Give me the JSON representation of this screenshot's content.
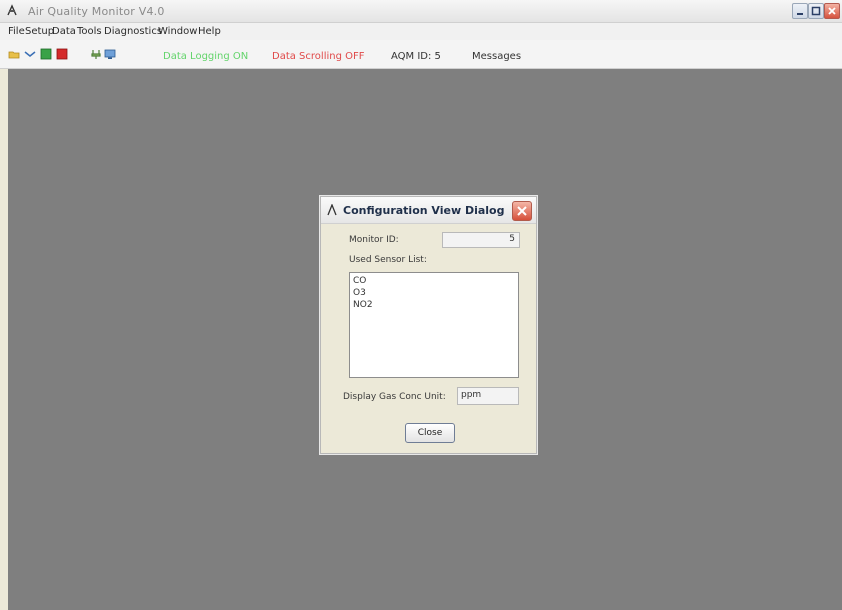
{
  "window": {
    "title": "Air Quality Monitor V4.0",
    "min_label": "",
    "max_label": "",
    "close_label": ""
  },
  "menu": [
    "File",
    "Setup",
    "Data",
    "Tools",
    "Diagnostics",
    "Window",
    "Help"
  ],
  "toolbar": {
    "status_data_logging": "Data Logging ON",
    "status_data_scrolling": "Data Scrolling OFF",
    "status_aqm_id": "AQM ID: 5",
    "status_messages": "Messages"
  },
  "colors": {
    "mdi_background": "#7f7f7f",
    "status_on": "#63d46b",
    "status_off": "#e04a4a"
  },
  "icons": {
    "title": "app-icon",
    "tool1": "folder-icon",
    "tool2": "chevron-down-icon",
    "tool3": "green-square-icon",
    "tool4": "red-square-icon",
    "tool5": "plug-icon",
    "tool6": "monitor-icon"
  },
  "dialog": {
    "title": "Configuration View Dialog",
    "monitor_id_label": "Monitor ID:",
    "monitor_id_value": "5",
    "used_sensor_list_label": "Used Sensor List:",
    "sensors": [
      "CO",
      "O3",
      "NO2"
    ],
    "display_unit_label": "Display Gas Conc Unit:",
    "display_unit_value": "ppm",
    "close_button": "Close"
  }
}
